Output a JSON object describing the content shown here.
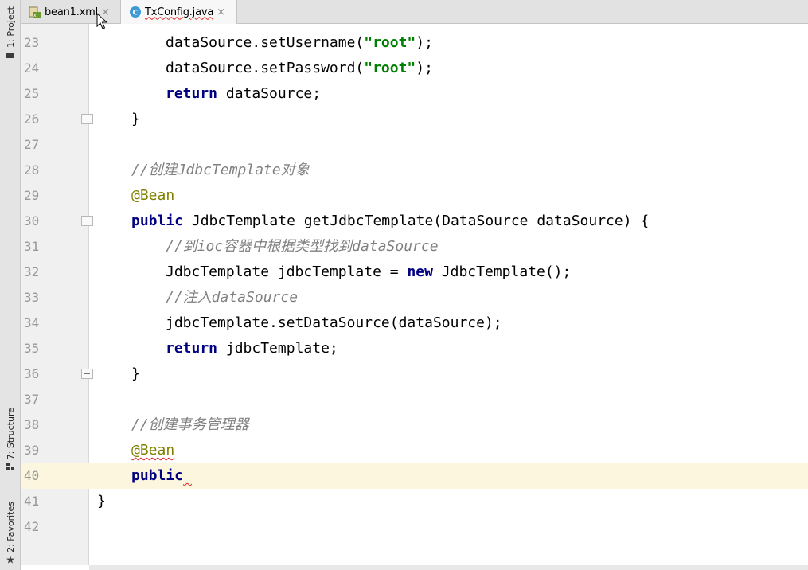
{
  "sidebar": {
    "project_label": "1: Project",
    "structure_label": "7: Structure",
    "favorites_label": "2: Favorites"
  },
  "tabs": [
    {
      "label": "bean1.xml",
      "icon": "xml-file-icon",
      "active": false
    },
    {
      "label": "TxConfig.java",
      "icon": "java-class-icon",
      "active": true
    }
  ],
  "tab_close_glyph": "×",
  "colors": {
    "keyword": "#000080",
    "string": "#008000",
    "comment": "#808080",
    "annotation": "#808000",
    "current_line": "#fcf6df"
  },
  "editor": {
    "current_line": 40,
    "lines": [
      {
        "num": "23",
        "indent": 2,
        "fold": false,
        "tokens": [
          {
            "t": "dataSource.setUsername(",
            "k": "plain"
          },
          {
            "t": "\"root\"",
            "k": "str"
          },
          {
            "t": ");",
            "k": "plain"
          }
        ]
      },
      {
        "num": "24",
        "indent": 2,
        "fold": false,
        "tokens": [
          {
            "t": "dataSource.setPassword(",
            "k": "plain"
          },
          {
            "t": "\"root\"",
            "k": "str"
          },
          {
            "t": ");",
            "k": "plain"
          }
        ]
      },
      {
        "num": "25",
        "indent": 2,
        "fold": false,
        "tokens": [
          {
            "t": "return",
            "k": "kw"
          },
          {
            "t": " dataSource;",
            "k": "plain"
          }
        ]
      },
      {
        "num": "26",
        "indent": 1,
        "fold": true,
        "tokens": [
          {
            "t": "}",
            "k": "plain"
          }
        ]
      },
      {
        "num": "27",
        "indent": 1,
        "fold": false,
        "tokens": []
      },
      {
        "num": "28",
        "indent": 1,
        "fold": false,
        "tokens": [
          {
            "t": "//创建JdbcTemplate对象",
            "k": "cmt"
          }
        ]
      },
      {
        "num": "29",
        "indent": 1,
        "fold": false,
        "tokens": [
          {
            "t": "@Bean",
            "k": "ann"
          }
        ]
      },
      {
        "num": "30",
        "indent": 1,
        "fold": true,
        "tokens": [
          {
            "t": "public",
            "k": "kw"
          },
          {
            "t": " JdbcTemplate getJdbcTemplate(DataSource dataSource) {",
            "k": "plain"
          }
        ]
      },
      {
        "num": "31",
        "indent": 2,
        "fold": false,
        "tokens": [
          {
            "t": "//到ioc容器中根据类型找到dataSource",
            "k": "cmt"
          }
        ]
      },
      {
        "num": "32",
        "indent": 2,
        "fold": false,
        "tokens": [
          {
            "t": "JdbcTemplate jdbcTemplate = ",
            "k": "plain"
          },
          {
            "t": "new",
            "k": "kw"
          },
          {
            "t": " JdbcTemplate();",
            "k": "plain"
          }
        ]
      },
      {
        "num": "33",
        "indent": 2,
        "fold": false,
        "tokens": [
          {
            "t": "//注入dataSource",
            "k": "cmt"
          }
        ]
      },
      {
        "num": "34",
        "indent": 2,
        "fold": false,
        "tokens": [
          {
            "t": "jdbcTemplate.setDataSource(dataSource);",
            "k": "plain"
          }
        ]
      },
      {
        "num": "35",
        "indent": 2,
        "fold": false,
        "tokens": [
          {
            "t": "return",
            "k": "kw"
          },
          {
            "t": " jdbcTemplate;",
            "k": "plain"
          }
        ]
      },
      {
        "num": "36",
        "indent": 1,
        "fold": true,
        "tokens": [
          {
            "t": "}",
            "k": "plain"
          }
        ]
      },
      {
        "num": "37",
        "indent": 1,
        "fold": false,
        "tokens": []
      },
      {
        "num": "38",
        "indent": 1,
        "fold": false,
        "tokens": [
          {
            "t": "//创建事务管理器",
            "k": "cmt"
          }
        ]
      },
      {
        "num": "39",
        "indent": 1,
        "fold": false,
        "tokens": [
          {
            "t": "@Bean",
            "k": "ann-err"
          }
        ]
      },
      {
        "num": "40",
        "indent": 1,
        "fold": false,
        "tokens": [
          {
            "t": "public",
            "k": "kw"
          },
          {
            "t": " ",
            "k": "caret-err"
          }
        ]
      },
      {
        "num": "41",
        "indent": 0,
        "fold": false,
        "tokens": [
          {
            "t": "}",
            "k": "plain"
          }
        ]
      },
      {
        "num": "42",
        "indent": 0,
        "fold": false,
        "tokens": []
      }
    ]
  }
}
